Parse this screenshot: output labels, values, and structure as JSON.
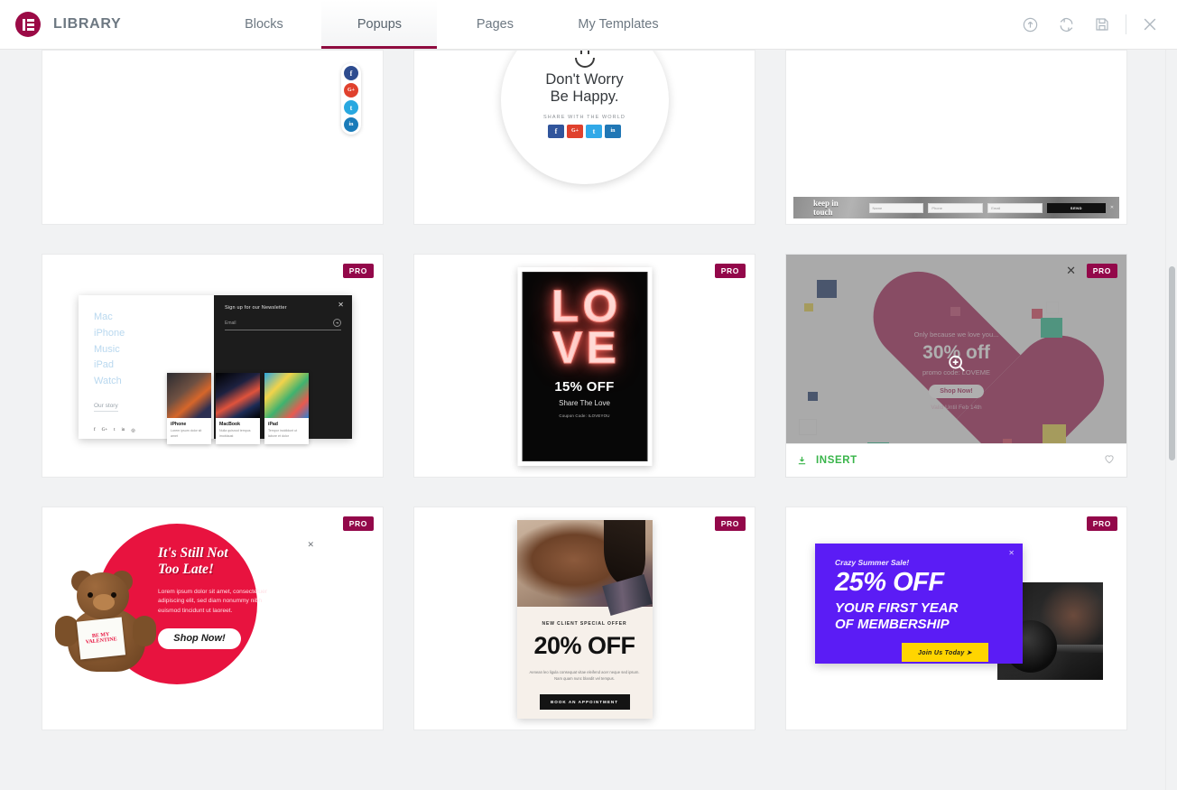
{
  "header": {
    "brand_title": "LIBRARY",
    "logo_icon": "elementor-logo-icon",
    "tabs": [
      {
        "label": "Blocks",
        "active": false
      },
      {
        "label": "Popups",
        "active": true
      },
      {
        "label": "Pages",
        "active": false
      },
      {
        "label": "My Templates",
        "active": false
      }
    ],
    "actions": [
      {
        "name": "upload-icon",
        "title": "Upload"
      },
      {
        "name": "sync-icon",
        "title": "Sync Library"
      },
      {
        "name": "save-icon",
        "title": "Save"
      },
      {
        "name": "close-icon",
        "title": "Close"
      }
    ]
  },
  "badges": {
    "pro": "PRO"
  },
  "hover_card": {
    "insert_label": "INSERT",
    "insert_icon": "download-icon",
    "favorite_icon": "heart-outline-icon",
    "zoom_icon": "magnifier-plus-icon",
    "close_icon": "close-icon"
  },
  "templates": {
    "social_rail": {
      "name": "social-share-rail",
      "items": [
        {
          "icon": "facebook-icon",
          "glyph": "f",
          "color": "#2d4b8e"
        },
        {
          "icon": "google-plus-icon",
          "glyph": "G+",
          "color": "#e0412d"
        },
        {
          "icon": "twitter-icon",
          "glyph": "t",
          "color": "#29a8e0"
        },
        {
          "icon": "linkedin-icon",
          "glyph": "in",
          "color": "#1a7bb9"
        }
      ]
    },
    "dont_worry": {
      "title_line1": "Don't Worry",
      "title_line2": "Be Happy.",
      "share_label": "SHARE WITH THE WORLD",
      "smiley_icon": "smiley-face-icon",
      "socials": [
        {
          "icon": "facebook-icon",
          "glyph": "f",
          "color": "#31559c"
        },
        {
          "icon": "google-plus-icon",
          "glyph": "G+",
          "color": "#e0412d"
        },
        {
          "icon": "twitter-icon",
          "glyph": "t",
          "color": "#31a9e8"
        },
        {
          "icon": "linkedin-icon",
          "glyph": "in",
          "color": "#2077b5"
        }
      ]
    },
    "keep_in_touch": {
      "title": "keep in touch",
      "fields": [
        "Name",
        "Phone",
        "Email"
      ],
      "send_label": "SEND",
      "close_icon": "close-icon"
    },
    "apple_newsletter": {
      "menu": [
        "Mac",
        "iPhone",
        "Music",
        "iPad",
        "Watch"
      ],
      "story_link": "Our story",
      "signup_title": "Sign up for our Newsletter",
      "email_placeholder": "Email",
      "submit_icon": "arrow-right-icon",
      "close_icon": "close-icon",
      "socials": [
        "facebook-icon",
        "google-plus-icon",
        "twitter-icon",
        "linkedin-icon",
        "instagram-icon"
      ],
      "social_glyphs": [
        "f",
        "G+",
        "t",
        "in",
        "◎"
      ],
      "products": [
        {
          "title": "iPhone",
          "text": "Lorem ipsum dolor sit amet"
        },
        {
          "title": "MacBook",
          "text": "Nulla quisnod tempus imoblaust"
        },
        {
          "title": "iPad",
          "text": "Tempor incididunt ut labore et dolor"
        }
      ]
    },
    "love_neon": {
      "neon_row1": [
        "L",
        "O"
      ],
      "neon_row2": [
        "V",
        "E"
      ],
      "offer": "15% OFF",
      "subtitle": "Share The Love",
      "coupon": "Coupon Code: ILOVEYOU"
    },
    "heart_offer": {
      "intro": "Only because we love you...",
      "offer": "30% off",
      "promo": "promo code: LOVEME",
      "button": "Shop Now!",
      "valid": "Valid Until Feb 14th",
      "heart_color": "#a8245a"
    },
    "teddy_valentine": {
      "title_line1": "It's Still Not",
      "title_line2": "Too Late!",
      "body": "Lorem ipsum dolor sit amet, consectetuer adipiscing elit, sed diam nonummy nibh euismod tincidunt ut laoreet.",
      "button": "Shop Now!",
      "card_line1": "BE MY",
      "card_line2": "VALENTINE",
      "close_icon": "close-icon",
      "circle_color": "#e8133f"
    },
    "beauty_offer": {
      "kicker": "NEW CLIENT SPECIAL OFFER",
      "offer": "20% OFF",
      "body": "Aenean leo ligula consequat vitae eleifend acer neque sed ipsum. Nam quam nunc blandit vel tempus.",
      "button": "BOOK AN APPOINTMENT"
    },
    "gym_membership": {
      "kicker": "Crazy Summer Sale!",
      "offer": "25% OFF",
      "sub_line1": "YOUR FIRST YEAR",
      "sub_line2": "OF MEMBERSHIP",
      "button": "Join Us Today  ➤",
      "close_icon": "close-icon",
      "panel_color": "#5b1cf5",
      "button_color": "#ffd500"
    }
  },
  "scrollbar": {
    "name": "vertical-scrollbar"
  }
}
